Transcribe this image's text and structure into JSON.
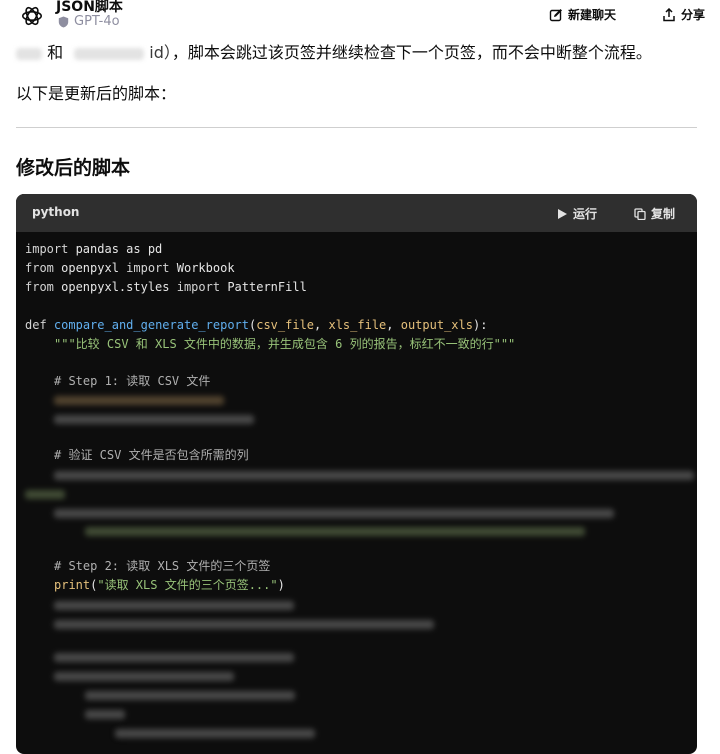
{
  "header": {
    "title": "JSON脚本",
    "model": "GPT-4o",
    "new_chat_label": "新建聊天",
    "share_label": "分享"
  },
  "message": {
    "line1_and": "和",
    "line1_id": "id）",
    "line1_rest": "，脚本会跳过该页签并继续检查下一个页签，而不会中断整个流程。",
    "line2": "以下是更新后的脚本：",
    "heading": "修改后的脚本"
  },
  "code_block": {
    "language": "python",
    "run_label": "运行",
    "copy_label": "复制",
    "lines": {
      "import_pandas": {
        "kw": "import",
        "rest": " pandas as pd"
      },
      "import_workbook": {
        "kw1": "from",
        "mod": " openpyxl ",
        "kw2": "import",
        "rest": " Workbook"
      },
      "import_pattern": {
        "kw1": "from",
        "mod": " openpyxl.styles ",
        "kw2": "import",
        "rest": " PatternFill"
      },
      "def_line": {
        "kw": "def",
        "fn": "compare_and_generate_report",
        "open": "(",
        "p1": "csv_file",
        "sep1": ", ",
        "p2": "xls_file",
        "sep2": ", ",
        "p3": "output_xls",
        "close": "):"
      },
      "docstring": "\"\"\"比较 CSV 和 XLS 文件中的数据，并生成包含 6 列的报告，标红不一致的行\"\"\"",
      "comment_step1": "# Step 1: 读取 CSV 文件",
      "comment_verify": "# 验证 CSV 文件是否包含所需的列",
      "comment_step2": "# Step 2: 读取 XLS 文件的三个页签",
      "print_fn": "print",
      "print_open": "(",
      "print_str": "\"读取 XLS 文件的三个页签...\"",
      "print_close": ")"
    }
  }
}
